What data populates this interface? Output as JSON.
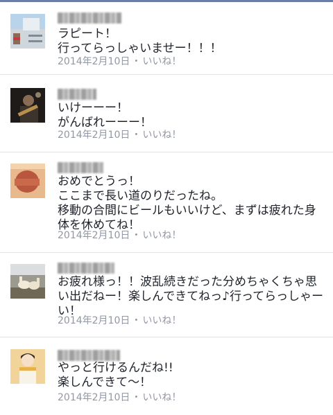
{
  "comments": [
    {
      "text": "ラピート！\n行ってらっしゃいませー！！！",
      "date": "2014年2月10日",
      "like_label": "いいね！"
    },
    {
      "text": "いけーーー！\nがんばれーーー！",
      "date": "2014年2月10日",
      "like_label": "いいね！"
    },
    {
      "text": "おめでとうっ！\nここまで長い道のりだったね。\n移動の合間にビールもいいけど、まずは疲れた身体を休めてね！",
      "date": "2014年2月10日",
      "like_label": "いいね！"
    },
    {
      "text": "お疲れ様っ！！波乱続きだった分めちゃくちゃ思い出だねー！楽しんできてねっ♪行ってらっしゃーい！",
      "date": "2014年2月10日",
      "like_label": "いいね！"
    },
    {
      "text": "やっと行けるんだね!!\n楽しんできて〜！",
      "date": "2014年2月10日",
      "like_label": "いいね！"
    }
  ],
  "meta_separator": "・",
  "colors": {
    "text": "#1d2129",
    "meta": "#9197a3",
    "divider": "#e1e3e8",
    "top_bar": "#6a7ea8"
  }
}
